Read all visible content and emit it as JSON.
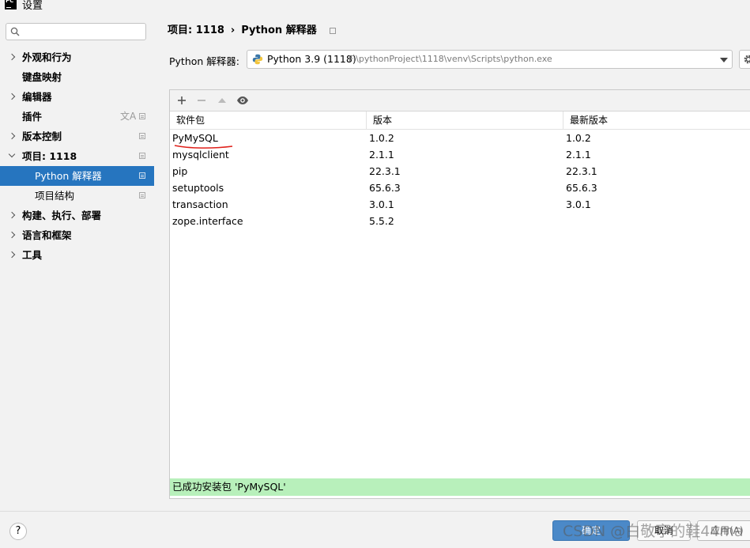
{
  "window": {
    "title": "设置",
    "logo_text": "PC"
  },
  "search": {
    "placeholder": "",
    "value": ""
  },
  "sidebar": {
    "items": [
      {
        "label": "外观和行为"
      },
      {
        "label": "键盘映射"
      },
      {
        "label": "编辑器"
      },
      {
        "label": "插件",
        "icon": "translate-icon"
      },
      {
        "label": "版本控制"
      },
      {
        "label": "项目: 1118"
      },
      {
        "label": "Python 解释器",
        "selected": true
      },
      {
        "label": "项目结构"
      },
      {
        "label": "构建、执行、部署"
      },
      {
        "label": "语言和框架"
      },
      {
        "label": "工具"
      }
    ]
  },
  "breadcrumb": {
    "project": "项目: 1118",
    "page": "Python 解释器"
  },
  "interpreter": {
    "label": "Python 解释器:",
    "name": "Python 3.9 (1118)",
    "path": "F:\\pythonProject\\1118\\venv\\Scripts\\python.exe"
  },
  "table": {
    "headers": [
      "软件包",
      "版本",
      "最新版本"
    ],
    "rows": [
      [
        "PyMySQL",
        "1.0.2",
        "1.0.2"
      ],
      [
        "mysqlclient",
        "2.1.1",
        "2.1.1"
      ],
      [
        "pip",
        "22.3.1",
        "22.3.1"
      ],
      [
        "setuptools",
        "65.6.3",
        "65.6.3"
      ],
      [
        "transaction",
        "3.0.1",
        "3.0.1"
      ],
      [
        "zope.interface",
        "5.5.2",
        ""
      ]
    ]
  },
  "status": {
    "message": "已成功安装包 'PyMySQL'"
  },
  "buttons": {
    "help": "?",
    "ok": "确定",
    "cancel": "取消",
    "apply": "应用(A)"
  },
  "watermark": "CSDN @白敬亭的鞋44ma",
  "colors": {
    "selected": "#2675bf",
    "status_bg": "#b8f0bb",
    "annotation": "#e0201a"
  }
}
